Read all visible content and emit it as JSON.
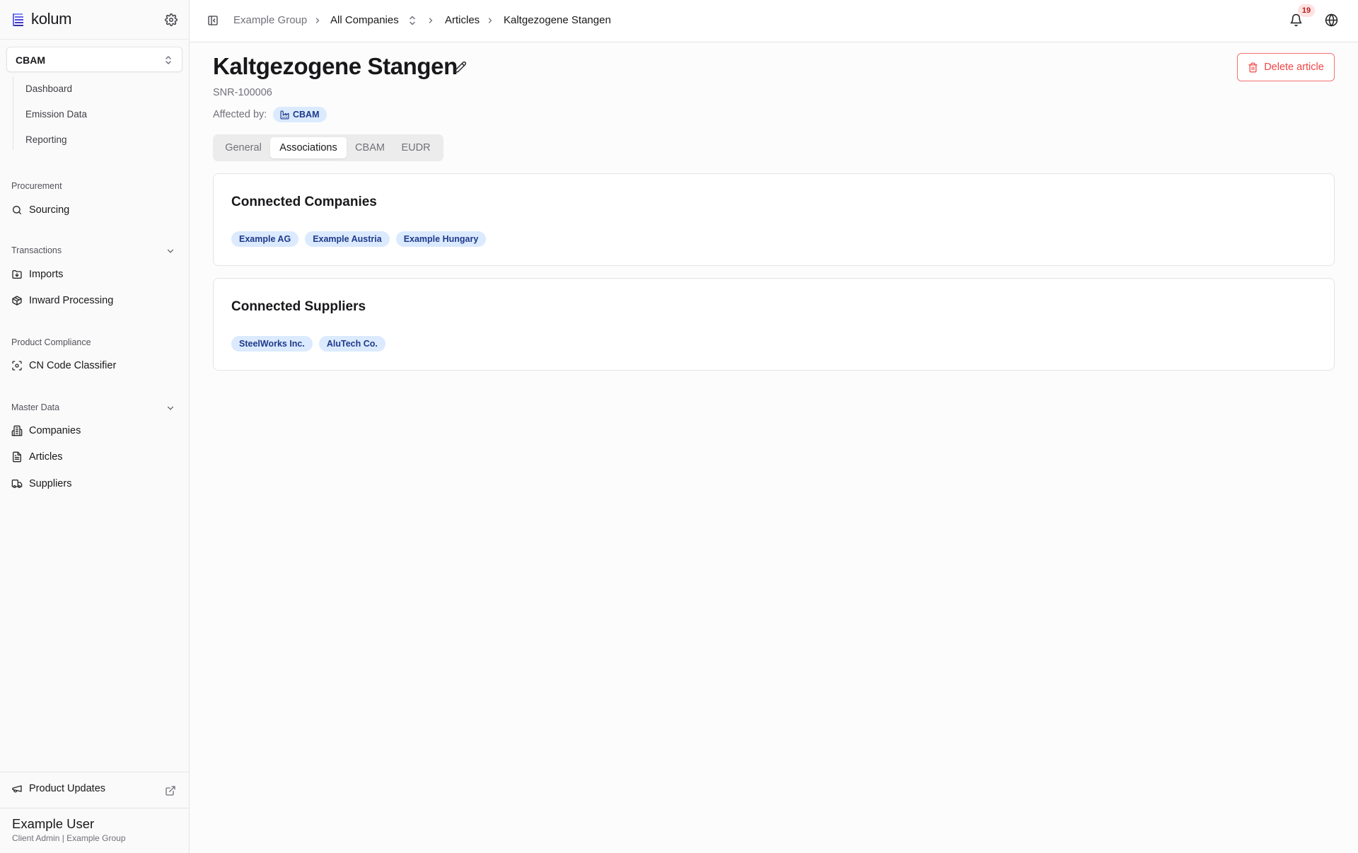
{
  "app": {
    "name": "kolum"
  },
  "sidebar": {
    "module_selector": {
      "value": "CBAM"
    },
    "module_items": [
      "Dashboard",
      "Emission Data",
      "Reporting"
    ],
    "sections": [
      {
        "title": "Procurement",
        "items": [
          {
            "label": "Sourcing",
            "icon": "search-icon"
          }
        ]
      },
      {
        "title": "Transactions",
        "items": [
          {
            "label": "Imports",
            "icon": "folder-import-icon"
          },
          {
            "label": "Inward Processing",
            "icon": "package-icon"
          }
        ]
      },
      {
        "title": "Product Compliance",
        "items": [
          {
            "label": "CN Code Classifier",
            "icon": "scan-icon"
          }
        ]
      },
      {
        "title": "Master Data",
        "items": [
          {
            "label": "Companies",
            "icon": "building-icon"
          },
          {
            "label": "Articles",
            "icon": "document-icon"
          },
          {
            "label": "Suppliers",
            "icon": "truck-icon"
          }
        ]
      }
    ],
    "product_updates": "Product Updates",
    "user": {
      "name": "Example User",
      "role": "Client Admin | Example Group"
    }
  },
  "topbar": {
    "breadcrumbs": [
      "Example Group",
      "All Companies",
      "Articles",
      "Kaltgezogene Stangen"
    ],
    "notification_count": "19"
  },
  "article": {
    "title": "Kaltgezogene Stangen",
    "id": "SNR-100006",
    "affected_by_label": "Affected by:",
    "affected_by": "CBAM",
    "delete_label": "Delete article"
  },
  "tabs": [
    {
      "label": "General",
      "active": false
    },
    {
      "label": "Associations",
      "active": true
    },
    {
      "label": "CBAM",
      "active": false
    },
    {
      "label": "EUDR",
      "active": false
    }
  ],
  "cards": [
    {
      "title": "Connected Companies",
      "chips": [
        "Example AG",
        "Example Austria",
        "Example Hungary"
      ]
    },
    {
      "title": "Connected Suppliers",
      "chips": [
        "SteelWorks Inc.",
        "AluTech Co."
      ]
    }
  ],
  "colors": {
    "accent_chip_bg": "#dbeafe",
    "accent_chip_text": "#1e3a8a",
    "danger": "#ef4444",
    "badge_bg": "#fee2e2"
  }
}
